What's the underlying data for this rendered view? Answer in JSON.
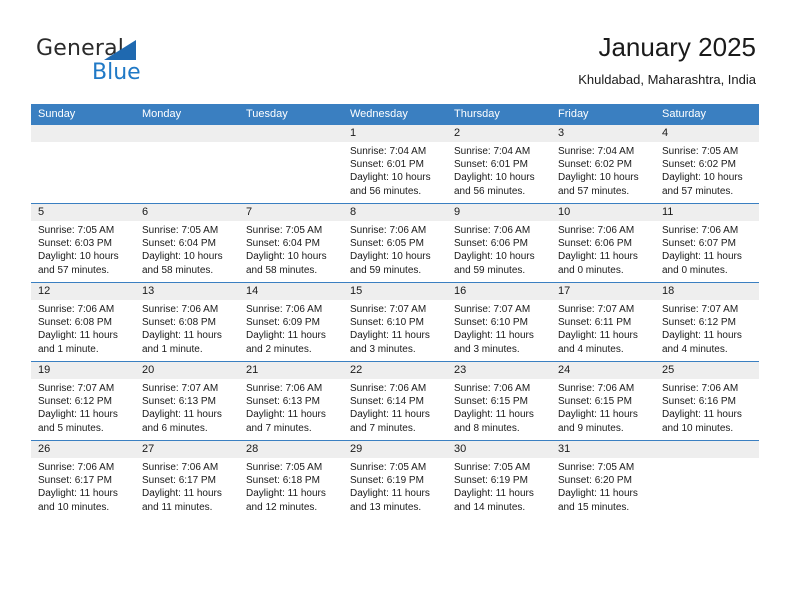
{
  "brand": {
    "name_part1": "General",
    "name_part2": "Blue",
    "accent_color": "#2079c6",
    "triangle_color": "#1f69b0",
    "icon": "triangle-logo-icon"
  },
  "header": {
    "title": "January 2025",
    "location": "Khuldabad, Maharashtra, India"
  },
  "calendar": {
    "header_bg": "#3a7fc1",
    "daynum_bg": "#eeeeee",
    "weekday_headers": [
      "Sunday",
      "Monday",
      "Tuesday",
      "Wednesday",
      "Thursday",
      "Friday",
      "Saturday"
    ],
    "weeks": [
      [
        {
          "day": "",
          "lines": []
        },
        {
          "day": "",
          "lines": []
        },
        {
          "day": "",
          "lines": []
        },
        {
          "day": "1",
          "lines": [
            "Sunrise: 7:04 AM",
            "Sunset: 6:01 PM",
            "Daylight: 10 hours",
            "and 56 minutes."
          ]
        },
        {
          "day": "2",
          "lines": [
            "Sunrise: 7:04 AM",
            "Sunset: 6:01 PM",
            "Daylight: 10 hours",
            "and 56 minutes."
          ]
        },
        {
          "day": "3",
          "lines": [
            "Sunrise: 7:04 AM",
            "Sunset: 6:02 PM",
            "Daylight: 10 hours",
            "and 57 minutes."
          ]
        },
        {
          "day": "4",
          "lines": [
            "Sunrise: 7:05 AM",
            "Sunset: 6:02 PM",
            "Daylight: 10 hours",
            "and 57 minutes."
          ]
        }
      ],
      [
        {
          "day": "5",
          "lines": [
            "Sunrise: 7:05 AM",
            "Sunset: 6:03 PM",
            "Daylight: 10 hours",
            "and 57 minutes."
          ]
        },
        {
          "day": "6",
          "lines": [
            "Sunrise: 7:05 AM",
            "Sunset: 6:04 PM",
            "Daylight: 10 hours",
            "and 58 minutes."
          ]
        },
        {
          "day": "7",
          "lines": [
            "Sunrise: 7:05 AM",
            "Sunset: 6:04 PM",
            "Daylight: 10 hours",
            "and 58 minutes."
          ]
        },
        {
          "day": "8",
          "lines": [
            "Sunrise: 7:06 AM",
            "Sunset: 6:05 PM",
            "Daylight: 10 hours",
            "and 59 minutes."
          ]
        },
        {
          "day": "9",
          "lines": [
            "Sunrise: 7:06 AM",
            "Sunset: 6:06 PM",
            "Daylight: 10 hours",
            "and 59 minutes."
          ]
        },
        {
          "day": "10",
          "lines": [
            "Sunrise: 7:06 AM",
            "Sunset: 6:06 PM",
            "Daylight: 11 hours",
            "and 0 minutes."
          ]
        },
        {
          "day": "11",
          "lines": [
            "Sunrise: 7:06 AM",
            "Sunset: 6:07 PM",
            "Daylight: 11 hours",
            "and 0 minutes."
          ]
        }
      ],
      [
        {
          "day": "12",
          "lines": [
            "Sunrise: 7:06 AM",
            "Sunset: 6:08 PM",
            "Daylight: 11 hours",
            "and 1 minute."
          ]
        },
        {
          "day": "13",
          "lines": [
            "Sunrise: 7:06 AM",
            "Sunset: 6:08 PM",
            "Daylight: 11 hours",
            "and 1 minute."
          ]
        },
        {
          "day": "14",
          "lines": [
            "Sunrise: 7:06 AM",
            "Sunset: 6:09 PM",
            "Daylight: 11 hours",
            "and 2 minutes."
          ]
        },
        {
          "day": "15",
          "lines": [
            "Sunrise: 7:07 AM",
            "Sunset: 6:10 PM",
            "Daylight: 11 hours",
            "and 3 minutes."
          ]
        },
        {
          "day": "16",
          "lines": [
            "Sunrise: 7:07 AM",
            "Sunset: 6:10 PM",
            "Daylight: 11 hours",
            "and 3 minutes."
          ]
        },
        {
          "day": "17",
          "lines": [
            "Sunrise: 7:07 AM",
            "Sunset: 6:11 PM",
            "Daylight: 11 hours",
            "and 4 minutes."
          ]
        },
        {
          "day": "18",
          "lines": [
            "Sunrise: 7:07 AM",
            "Sunset: 6:12 PM",
            "Daylight: 11 hours",
            "and 4 minutes."
          ]
        }
      ],
      [
        {
          "day": "19",
          "lines": [
            "Sunrise: 7:07 AM",
            "Sunset: 6:12 PM",
            "Daylight: 11 hours",
            "and 5 minutes."
          ]
        },
        {
          "day": "20",
          "lines": [
            "Sunrise: 7:07 AM",
            "Sunset: 6:13 PM",
            "Daylight: 11 hours",
            "and 6 minutes."
          ]
        },
        {
          "day": "21",
          "lines": [
            "Sunrise: 7:06 AM",
            "Sunset: 6:13 PM",
            "Daylight: 11 hours",
            "and 7 minutes."
          ]
        },
        {
          "day": "22",
          "lines": [
            "Sunrise: 7:06 AM",
            "Sunset: 6:14 PM",
            "Daylight: 11 hours",
            "and 7 minutes."
          ]
        },
        {
          "day": "23",
          "lines": [
            "Sunrise: 7:06 AM",
            "Sunset: 6:15 PM",
            "Daylight: 11 hours",
            "and 8 minutes."
          ]
        },
        {
          "day": "24",
          "lines": [
            "Sunrise: 7:06 AM",
            "Sunset: 6:15 PM",
            "Daylight: 11 hours",
            "and 9 minutes."
          ]
        },
        {
          "day": "25",
          "lines": [
            "Sunrise: 7:06 AM",
            "Sunset: 6:16 PM",
            "Daylight: 11 hours",
            "and 10 minutes."
          ]
        }
      ],
      [
        {
          "day": "26",
          "lines": [
            "Sunrise: 7:06 AM",
            "Sunset: 6:17 PM",
            "Daylight: 11 hours",
            "and 10 minutes."
          ]
        },
        {
          "day": "27",
          "lines": [
            "Sunrise: 7:06 AM",
            "Sunset: 6:17 PM",
            "Daylight: 11 hours",
            "and 11 minutes."
          ]
        },
        {
          "day": "28",
          "lines": [
            "Sunrise: 7:05 AM",
            "Sunset: 6:18 PM",
            "Daylight: 11 hours",
            "and 12 minutes."
          ]
        },
        {
          "day": "29",
          "lines": [
            "Sunrise: 7:05 AM",
            "Sunset: 6:19 PM",
            "Daylight: 11 hours",
            "and 13 minutes."
          ]
        },
        {
          "day": "30",
          "lines": [
            "Sunrise: 7:05 AM",
            "Sunset: 6:19 PM",
            "Daylight: 11 hours",
            "and 14 minutes."
          ]
        },
        {
          "day": "31",
          "lines": [
            "Sunrise: 7:05 AM",
            "Sunset: 6:20 PM",
            "Daylight: 11 hours",
            "and 15 minutes."
          ]
        },
        {
          "day": "",
          "lines": []
        }
      ]
    ]
  }
}
